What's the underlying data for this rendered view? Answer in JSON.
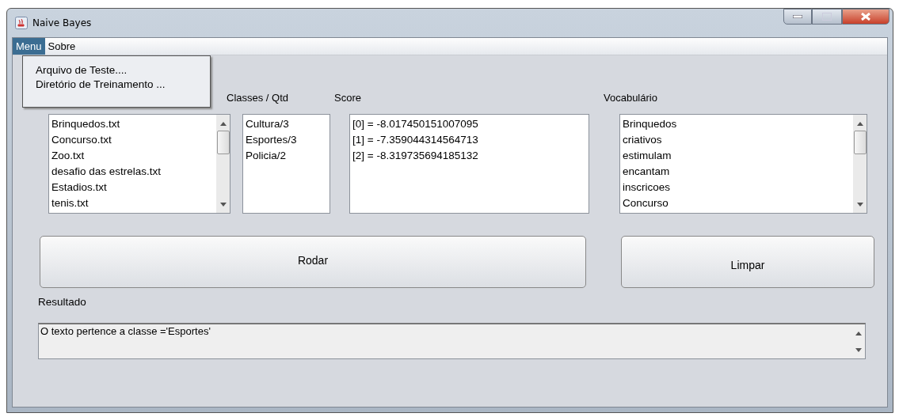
{
  "window": {
    "title": "Naive Bayes"
  },
  "menu_bar": [
    {
      "label": "Menu",
      "selected": true
    },
    {
      "label": "Sobre",
      "selected": false
    }
  ],
  "open_menu": {
    "items": [
      "Arquivo de Teste....",
      "Diretório de Treinamento ..."
    ]
  },
  "files_list": {
    "items": [
      "Brinquedos.txt",
      "Concurso.txt",
      "Zoo.txt",
      "desafio das estrelas.txt",
      "Estadios.txt",
      "tenis.txt"
    ]
  },
  "classes": {
    "label": "Classes / Qtd",
    "items": [
      "Cultura/3",
      "Esportes/3",
      "Policia/2"
    ]
  },
  "score": {
    "label": "Score",
    "items": [
      "[0]  = -8.017450151007095",
      "[1]  = -7.359044314564713",
      "[2]  = -8.319735694185132"
    ]
  },
  "vocabulary": {
    "label": "Vocabulário",
    "items": [
      "Brinquedos",
      "criativos",
      "estimulam",
      "encantam",
      "inscricoes",
      "Concurso"
    ]
  },
  "buttons": [
    "Rodar",
    "Limpar"
  ],
  "result": {
    "label": "Resultado",
    "value": "O texto pertence a classe ='Esportes'"
  }
}
